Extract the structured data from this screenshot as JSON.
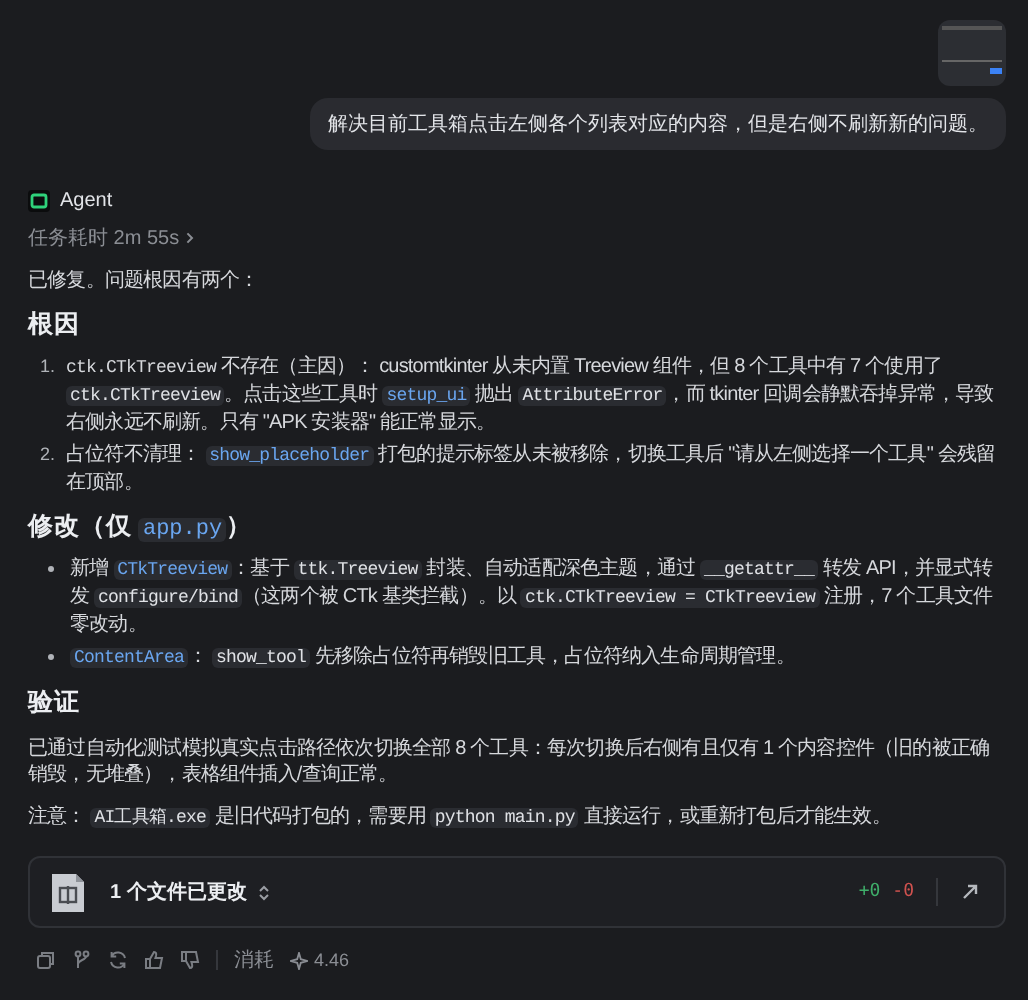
{
  "user_message": {
    "text": "解决目前工具箱点击左侧各个列表对应的内容，但是右侧不刷新新的问题。"
  },
  "agent": {
    "name": "Agent",
    "duration": "任务耗时 2m 55s"
  },
  "intro": "已修复。问题根因有两个：",
  "sections": [
    {
      "heading": [
        {
          "kind": "text",
          "text": "根因"
        }
      ],
      "items": [
        {
          "number": "1.",
          "segments": [
            {
              "kind": "mono",
              "text": "ctk.CTkTreeview"
            },
            {
              "kind": "text",
              "text": " 不存在（主因）： customtkinter 从未内置 Treeview 组件，但 8 个工具中有 7 个使用了 "
            },
            {
              "kind": "code",
              "text": "ctk.CTkTreeview"
            },
            {
              "kind": "text",
              "text": "。点击这些工具时 "
            },
            {
              "kind": "symbol",
              "text": "setup_ui"
            },
            {
              "kind": "text",
              "text": " 抛出 "
            },
            {
              "kind": "code",
              "text": "AttributeError"
            },
            {
              "kind": "text",
              "text": "，而 tkinter 回调会静默吞掉异常，导致右侧永远不刷新。只有 \"APK 安装器\" 能正常显示。"
            }
          ]
        },
        {
          "number": "2.",
          "segments": [
            {
              "kind": "text",
              "text": "占位符不清理： "
            },
            {
              "kind": "symbol",
              "text": "show_placeholder"
            },
            {
              "kind": "text",
              "text": " 打包的提示标签从未被移除，切换工具后 \"请从左侧选择一个工具\" 会残留在顶部。"
            }
          ]
        }
      ]
    },
    {
      "heading": [
        {
          "kind": "text",
          "text": "修改（仅 "
        },
        {
          "kind": "symbol",
          "text": "app.py"
        },
        {
          "kind": "text",
          "text": "）"
        }
      ],
      "items": [
        {
          "segments": [
            {
              "kind": "text",
              "text": "新增 "
            },
            {
              "kind": "symbol",
              "text": "CTkTreeview"
            },
            {
              "kind": "text",
              "text": "：基于 "
            },
            {
              "kind": "code",
              "text": "ttk.Treeview"
            },
            {
              "kind": "text",
              "text": " 封装、自动适配深色主题，通过 "
            },
            {
              "kind": "code",
              "text": "__getattr__"
            },
            {
              "kind": "text",
              "text": " 转发 API，并显式转发 "
            },
            {
              "kind": "code",
              "text": "configure/bind"
            },
            {
              "kind": "text",
              "text": "（这两个被 CTk 基类拦截）。以 "
            },
            {
              "kind": "code",
              "text": "ctk.CTkTreeview = CTkTreeview"
            },
            {
              "kind": "text",
              "text": " 注册，7 个工具文件零改动。"
            }
          ]
        },
        {
          "segments": [
            {
              "kind": "symbol",
              "text": "ContentArea"
            },
            {
              "kind": "text",
              "text": "： "
            },
            {
              "kind": "code",
              "text": "show_tool"
            },
            {
              "kind": "text",
              "text": " 先移除占位符再销毁旧工具，占位符纳入生命周期管理。"
            }
          ]
        }
      ]
    },
    {
      "heading": [
        {
          "kind": "text",
          "text": "验证"
        }
      ]
    }
  ],
  "paragraphs": [
    [
      {
        "kind": "text",
        "text": "已通过自动化测试模拟真实点击路径依次切换全部 8 个工具：每次切换后右侧有且仅有 1 个内容控件（旧的被正确销毁，无堆叠），表格组件插入/查询正常。"
      }
    ],
    [
      {
        "kind": "text",
        "text": "注意： "
      },
      {
        "kind": "code",
        "text": "AI工具箱.exe"
      },
      {
        "kind": "text",
        "text": " 是旧代码打包的，需要用 "
      },
      {
        "kind": "code",
        "text": "python main.py"
      },
      {
        "kind": "text",
        "text": " 直接运行，或重新打包后才能生效。"
      }
    ]
  ],
  "files_card": {
    "title": "1 个文件已更改",
    "added": "+0",
    "removed": "-0"
  },
  "footer": {
    "cost_label": "消耗",
    "cost": "4.46"
  }
}
